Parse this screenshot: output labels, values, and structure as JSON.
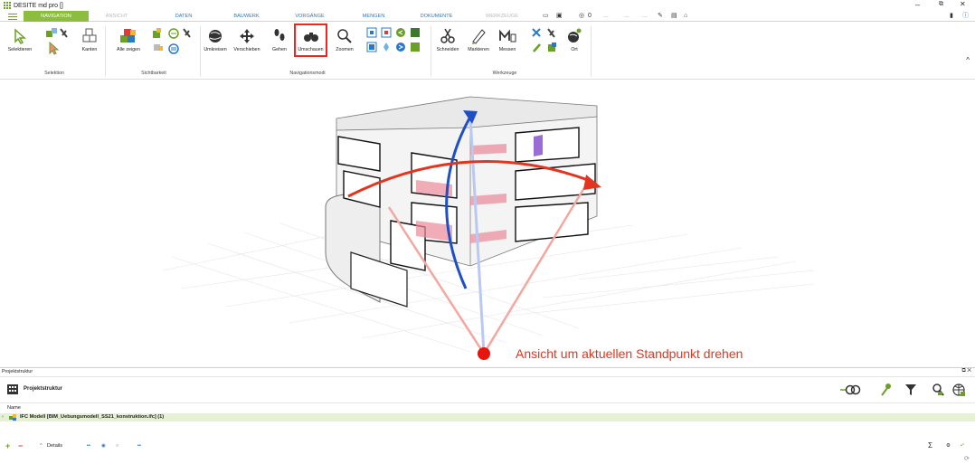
{
  "window": {
    "title": "DESITE md pro []",
    "minimize": "–",
    "maximize": "⧉",
    "close": "✕"
  },
  "tabs": [
    {
      "label": "NAVIGATION",
      "state": "active"
    },
    {
      "label": "ANSICHT",
      "state": "disabled"
    },
    {
      "label": "DATEN",
      "state": "normal"
    },
    {
      "label": "BAUWERK",
      "state": "normal"
    },
    {
      "label": "VORGÄNGE",
      "state": "normal"
    },
    {
      "label": "MENGEN",
      "state": "normal"
    },
    {
      "label": "DOKUMENTE",
      "state": "normal"
    },
    {
      "label": "WERKZEUGE",
      "state": "disabled"
    }
  ],
  "quick_access": {
    "counter": "0",
    "dots1": "...",
    "dots2": "...",
    "dots3": "..."
  },
  "ribbon": {
    "buttons": {
      "selektieren": "Selektieren",
      "kanten": "Kanten",
      "alle_zeigen": "Alle zeigen",
      "umkreisen": "Umkreisen",
      "verschieben": "Verschieben",
      "gehen": "Gehen",
      "umschauen": "Umschauen",
      "zoomen": "Zoomen",
      "schneiden": "Schneiden",
      "markieren": "Markieren",
      "messen": "Messen",
      "ort": "Ort"
    },
    "groups": {
      "selektion": "Selektion",
      "sichtbarkeit": "Sichtbarkeit",
      "navigationsmodi": "Navigationsmodi",
      "werkzeuge": "Werkzeuge"
    },
    "collapse": "^"
  },
  "viewport": {
    "annotation": "Ansicht um aktuellen Standpunkt drehen"
  },
  "colors": {
    "accent": "#8cbd3f",
    "highlight": "#e9291f",
    "arrow_red": "#e2351f",
    "arrow_blue": "#1f4fc7"
  },
  "panel": {
    "header": "Projektstruktur",
    "controls": "⧉ ✕",
    "title": "Projektstruktur",
    "column_name": "Name",
    "rows": [
      {
        "label": "IFC Modell [BIM_Uebungsmodell_SS21_konstruktion.ifc] (1)"
      }
    ],
    "bottom": {
      "add": "+",
      "remove": "−",
      "details": "Details",
      "sigma": "Σ"
    }
  }
}
